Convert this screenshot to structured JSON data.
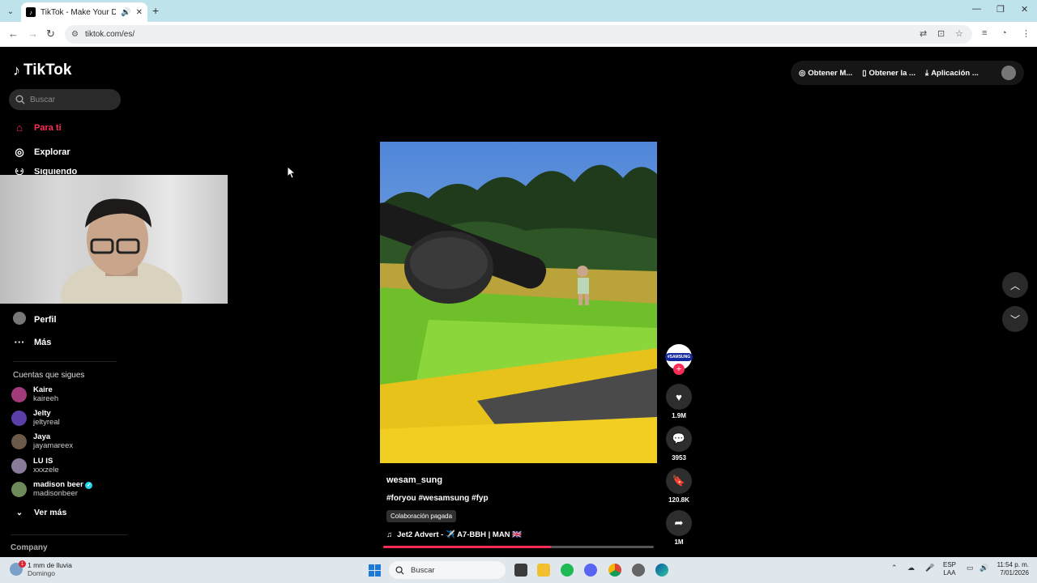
{
  "browser": {
    "tab_title": "TikTok - Make Your Day",
    "url": "tiktok.com/es/"
  },
  "tiktok": {
    "logo_text": "TikTok",
    "search_placeholder": "Buscar",
    "nav": [
      {
        "label": "Para ti",
        "icon": "home-icon"
      },
      {
        "label": "Explorar",
        "icon": "compass-icon"
      },
      {
        "label": "Siguiendo",
        "icon": "following-icon"
      },
      {
        "label": "Perfil",
        "icon": "avatar"
      },
      {
        "label": "Más",
        "icon": "more-icon"
      }
    ],
    "following_title": "Cuentas que sigues",
    "following": [
      {
        "name": "Kaire",
        "handle": "kaireeh",
        "avatar_color": "#a33b7a"
      },
      {
        "name": "Jelty",
        "handle": "jeltyreal",
        "avatar_color": "#5a3fa8"
      },
      {
        "name": "Jaya",
        "handle": "jayamareex",
        "avatar_color": "#6b5a4a"
      },
      {
        "name": "LU IS",
        "handle": "xxxzele",
        "avatar_color": "#8a7a9a"
      },
      {
        "name": "madison beer",
        "handle": "madisonbeer",
        "avatar_color": "#6f8a5a"
      }
    ],
    "see_more": "Ver más",
    "company": "Company",
    "header_links": [
      "Obtener M...",
      "Obtener la ...",
      "Aplicación ..."
    ],
    "video": {
      "author": "wesam_sung",
      "caption": "#foryou #wesamsung #fyp",
      "badge": "Colaboración pagada",
      "music": "Jet2 Advert - ✈️ A7-BBH | MAN 🇬🇧",
      "progress": 0.62
    },
    "actions": {
      "likes": "1.9M",
      "comments": "3953",
      "saves": "120.8K",
      "shares": "1M"
    },
    "channel_badge": "#SAMSUNG"
  },
  "taskbar": {
    "weather_line1": "1 mm de lluvia",
    "weather_line2": "Domingo",
    "weather_badge": "1",
    "search": "Buscar",
    "lang1": "ESP",
    "lang2": "LAA",
    "time": "11:54 p. m.",
    "date": "7/01/2026"
  },
  "colors": {
    "accent": "#fe2c55",
    "tabbar": "#bfe3ea"
  }
}
